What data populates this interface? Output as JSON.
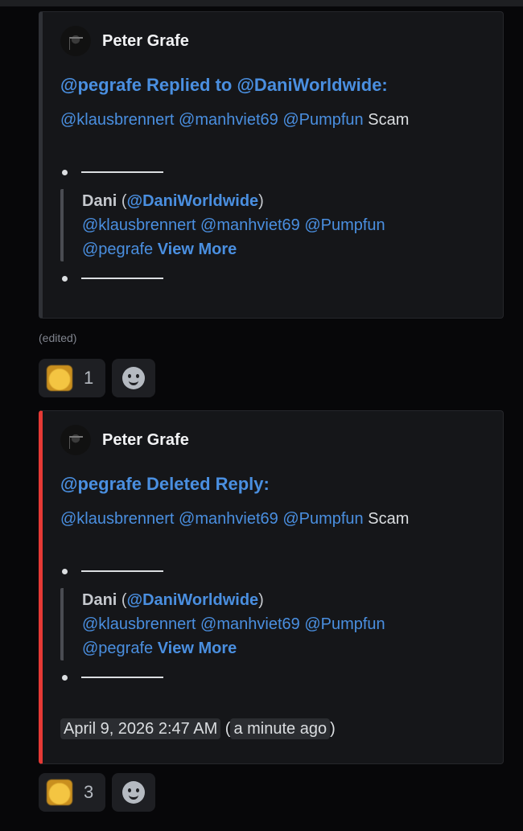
{
  "messages": [
    {
      "author": "Peter Grafe",
      "title": "@pegrafe Replied to @DaniWorldwide:",
      "body_mentions": [
        "@klausbrennert",
        "@manhviet69",
        "@Pumpfun"
      ],
      "body_text": "Scam",
      "quote": {
        "author": "Dani",
        "open_paren": "(",
        "handle": "@DaniWorldwide",
        "close_paren": ")",
        "mentions_line1": [
          "@klausbrennert",
          "@manhviet69",
          "@Pumpfun"
        ],
        "mention_line2": "@pegrafe",
        "view_more": "View More"
      },
      "edited": "(edited)",
      "reaction": {
        "emoji": "crying-face",
        "count": "1"
      }
    },
    {
      "author": "Peter Grafe",
      "title": "@pegrafe Deleted Reply:",
      "body_mentions": [
        "@klausbrennert",
        "@manhviet69",
        "@Pumpfun"
      ],
      "body_text": "Scam",
      "quote": {
        "author": "Dani",
        "open_paren": "(",
        "handle": "@DaniWorldwide",
        "close_paren": ")",
        "mentions_line1": [
          "@klausbrennert",
          "@manhviet69",
          "@Pumpfun"
        ],
        "mention_line2": "@pegrafe",
        "view_more": "View More"
      },
      "timestamp": "April 9, 2026 2:47 AM",
      "ts_open": "(",
      "relative": "a minute ago",
      "ts_close": ")",
      "reaction": {
        "emoji": "crying-face",
        "count": "3"
      }
    }
  ],
  "colors": {
    "accent": "#4a8fe0",
    "deleted_bar": "#e53935",
    "background": "#070709",
    "embed": "#151619"
  }
}
